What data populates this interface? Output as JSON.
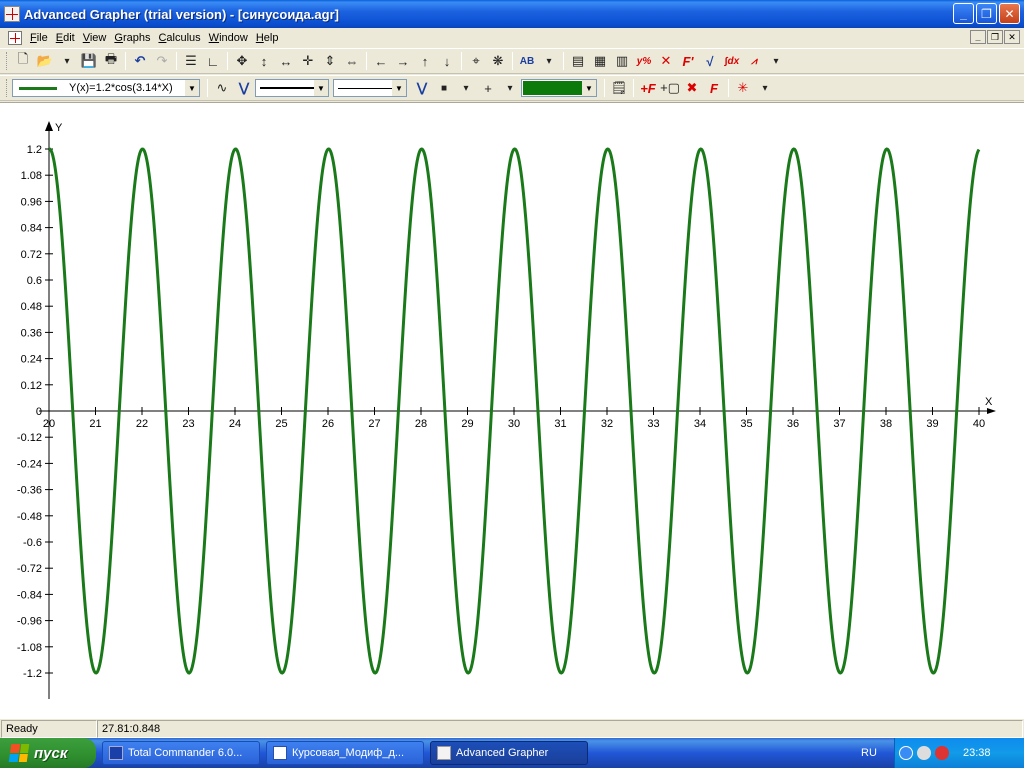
{
  "window": {
    "title": "Advanced Grapher (trial version) - [синусоида.agr]",
    "minimize": "_",
    "maximize": "❐",
    "close": "✕"
  },
  "menu": {
    "items": [
      {
        "u": "F",
        "rest": "ile"
      },
      {
        "u": "E",
        "rest": "dit"
      },
      {
        "u": "V",
        "rest": "iew"
      },
      {
        "u": "G",
        "rest": "raphs"
      },
      {
        "u": "C",
        "rest": "alculus"
      },
      {
        "u": "W",
        "rest": "indow"
      },
      {
        "u": "H",
        "rest": "elp"
      }
    ],
    "mdi_minimize": "_",
    "mdi_restore": "❐",
    "mdi_close": "✕"
  },
  "toolbar2": {
    "function_label": "Y(x)=1.2*cos(3.14*X)",
    "line_color": "#1a7a1a",
    "fill_color": "#0b7a0b",
    "marker": "■",
    "cross": "+",
    "text_ab": "AB"
  },
  "chart_data": {
    "type": "line",
    "function": "Y(x)=1.2*cos(3.14*X)",
    "amplitude": 1.2,
    "frequency": 3.14,
    "xlim": [
      20,
      40
    ],
    "ylim": [
      -1.2,
      1.2
    ],
    "x_ticks": [
      "20",
      "21",
      "22",
      "23",
      "24",
      "25",
      "26",
      "27",
      "28",
      "29",
      "30",
      "31",
      "32",
      "33",
      "34",
      "35",
      "36",
      "37",
      "38",
      "39",
      "40"
    ],
    "y_ticks": [
      "1.2",
      "1.08",
      "0.96",
      "0.84",
      "0.72",
      "0.6",
      "0.48",
      "0.36",
      "0.24",
      "0.12",
      "0",
      "-0.12",
      "-0.24",
      "-0.36",
      "-0.48",
      "-0.6",
      "-0.72",
      "-0.84",
      "-0.96",
      "-1.08",
      "-1.2"
    ],
    "xlabel": "X",
    "ylabel": "Y",
    "series_color": "#1a7a1a"
  },
  "status": {
    "state": "Ready",
    "coords": "27.81:0.848"
  },
  "taskbar": {
    "start": "пуск",
    "tasks": [
      {
        "label": "Total Commander 6.0...",
        "active": false
      },
      {
        "label": "Курсовая_Модиф_д...",
        "active": false
      },
      {
        "label": "Advanced Grapher",
        "active": true
      }
    ],
    "lang": "RU",
    "time": "23:38"
  }
}
